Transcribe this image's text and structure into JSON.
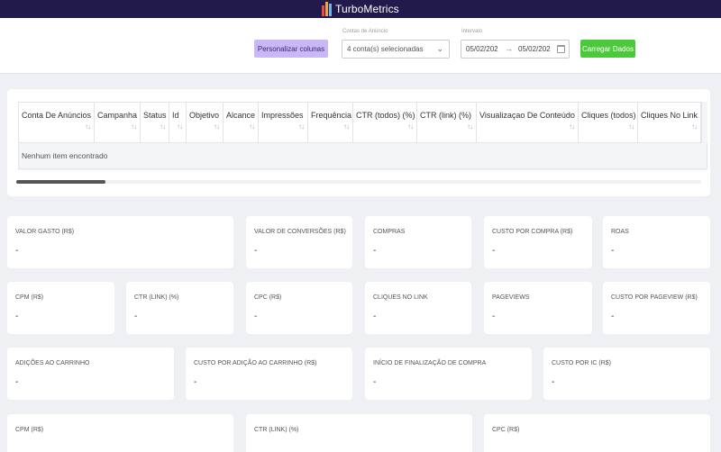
{
  "app": {
    "title": "TurboMetrics",
    "logo_colors": [
      "#e94b3c",
      "#f3a33a",
      "#6fb6e8"
    ]
  },
  "toolbar": {
    "customize_columns_label": "Personalizar colunas",
    "accounts_label": "Contas de Anúncio",
    "accounts_value": "4 conta(s) selecionadas",
    "interval_label": "Intervalo",
    "date_start": "05/02/202",
    "date_end": "05/02/202",
    "load_label": "Carregar Dados",
    "accent_purple": "#c9b8f5",
    "accent_green": "#4cc93a"
  },
  "table": {
    "columns": [
      {
        "label": "Conta De Anúncios"
      },
      {
        "label": "Campanha"
      },
      {
        "label": "Status"
      },
      {
        "label": "Id"
      },
      {
        "label": "Objetivo"
      },
      {
        "label": "Alcance"
      },
      {
        "label": "Impressões"
      },
      {
        "label": "Frequência"
      },
      {
        "label": "CTR (todos) (%)"
      },
      {
        "label": "CTR (link) (%)"
      },
      {
        "label": "Visualizaçao De Conteúdo"
      },
      {
        "label": "Cliques (todos)"
      },
      {
        "label": "Cliques No Link"
      }
    ],
    "empty_text": "Nenhum item encontrado",
    "scroll_fraction": 0.13
  },
  "metrics": [
    {
      "title": "VALOR GASTO (R$)",
      "value": "-"
    },
    {
      "title": "VALOR DE CONVERSÕES (R$)",
      "value": "-"
    },
    {
      "title": "COMPRAS",
      "value": "-"
    },
    {
      "title": "CUSTO POR COMPRA (R$)",
      "value": "-"
    },
    {
      "title": "ROAS",
      "value": "-"
    },
    {
      "title": "CPM (R$)",
      "value": "-"
    },
    {
      "title": "CTR (LINK) (%)",
      "value": "-"
    },
    {
      "title": "CPC (R$)",
      "value": "-"
    },
    {
      "title": "CLIQUES NO LINK",
      "value": "-"
    },
    {
      "title": "PAGEVIEWS",
      "value": "-"
    },
    {
      "title": "CUSTO POR PAGEVIEW (R$)",
      "value": "-"
    },
    {
      "title": "ADIÇÕES AO CARRINHO",
      "value": "-"
    },
    {
      "title": "CUSTO POR ADIÇÃO AO CARRINHO (R$)",
      "value": "-"
    },
    {
      "title": "INÍCIO DE FINALIZAÇÃO DE COMPRA",
      "value": "-"
    },
    {
      "title": "CUSTO POR IC (R$)",
      "value": "-"
    },
    {
      "title": "CPM (R$)",
      "value": ""
    },
    {
      "title": "CTR (LINK) (%)",
      "value": ""
    },
    {
      "title": "CPC (R$)",
      "value": ""
    }
  ]
}
